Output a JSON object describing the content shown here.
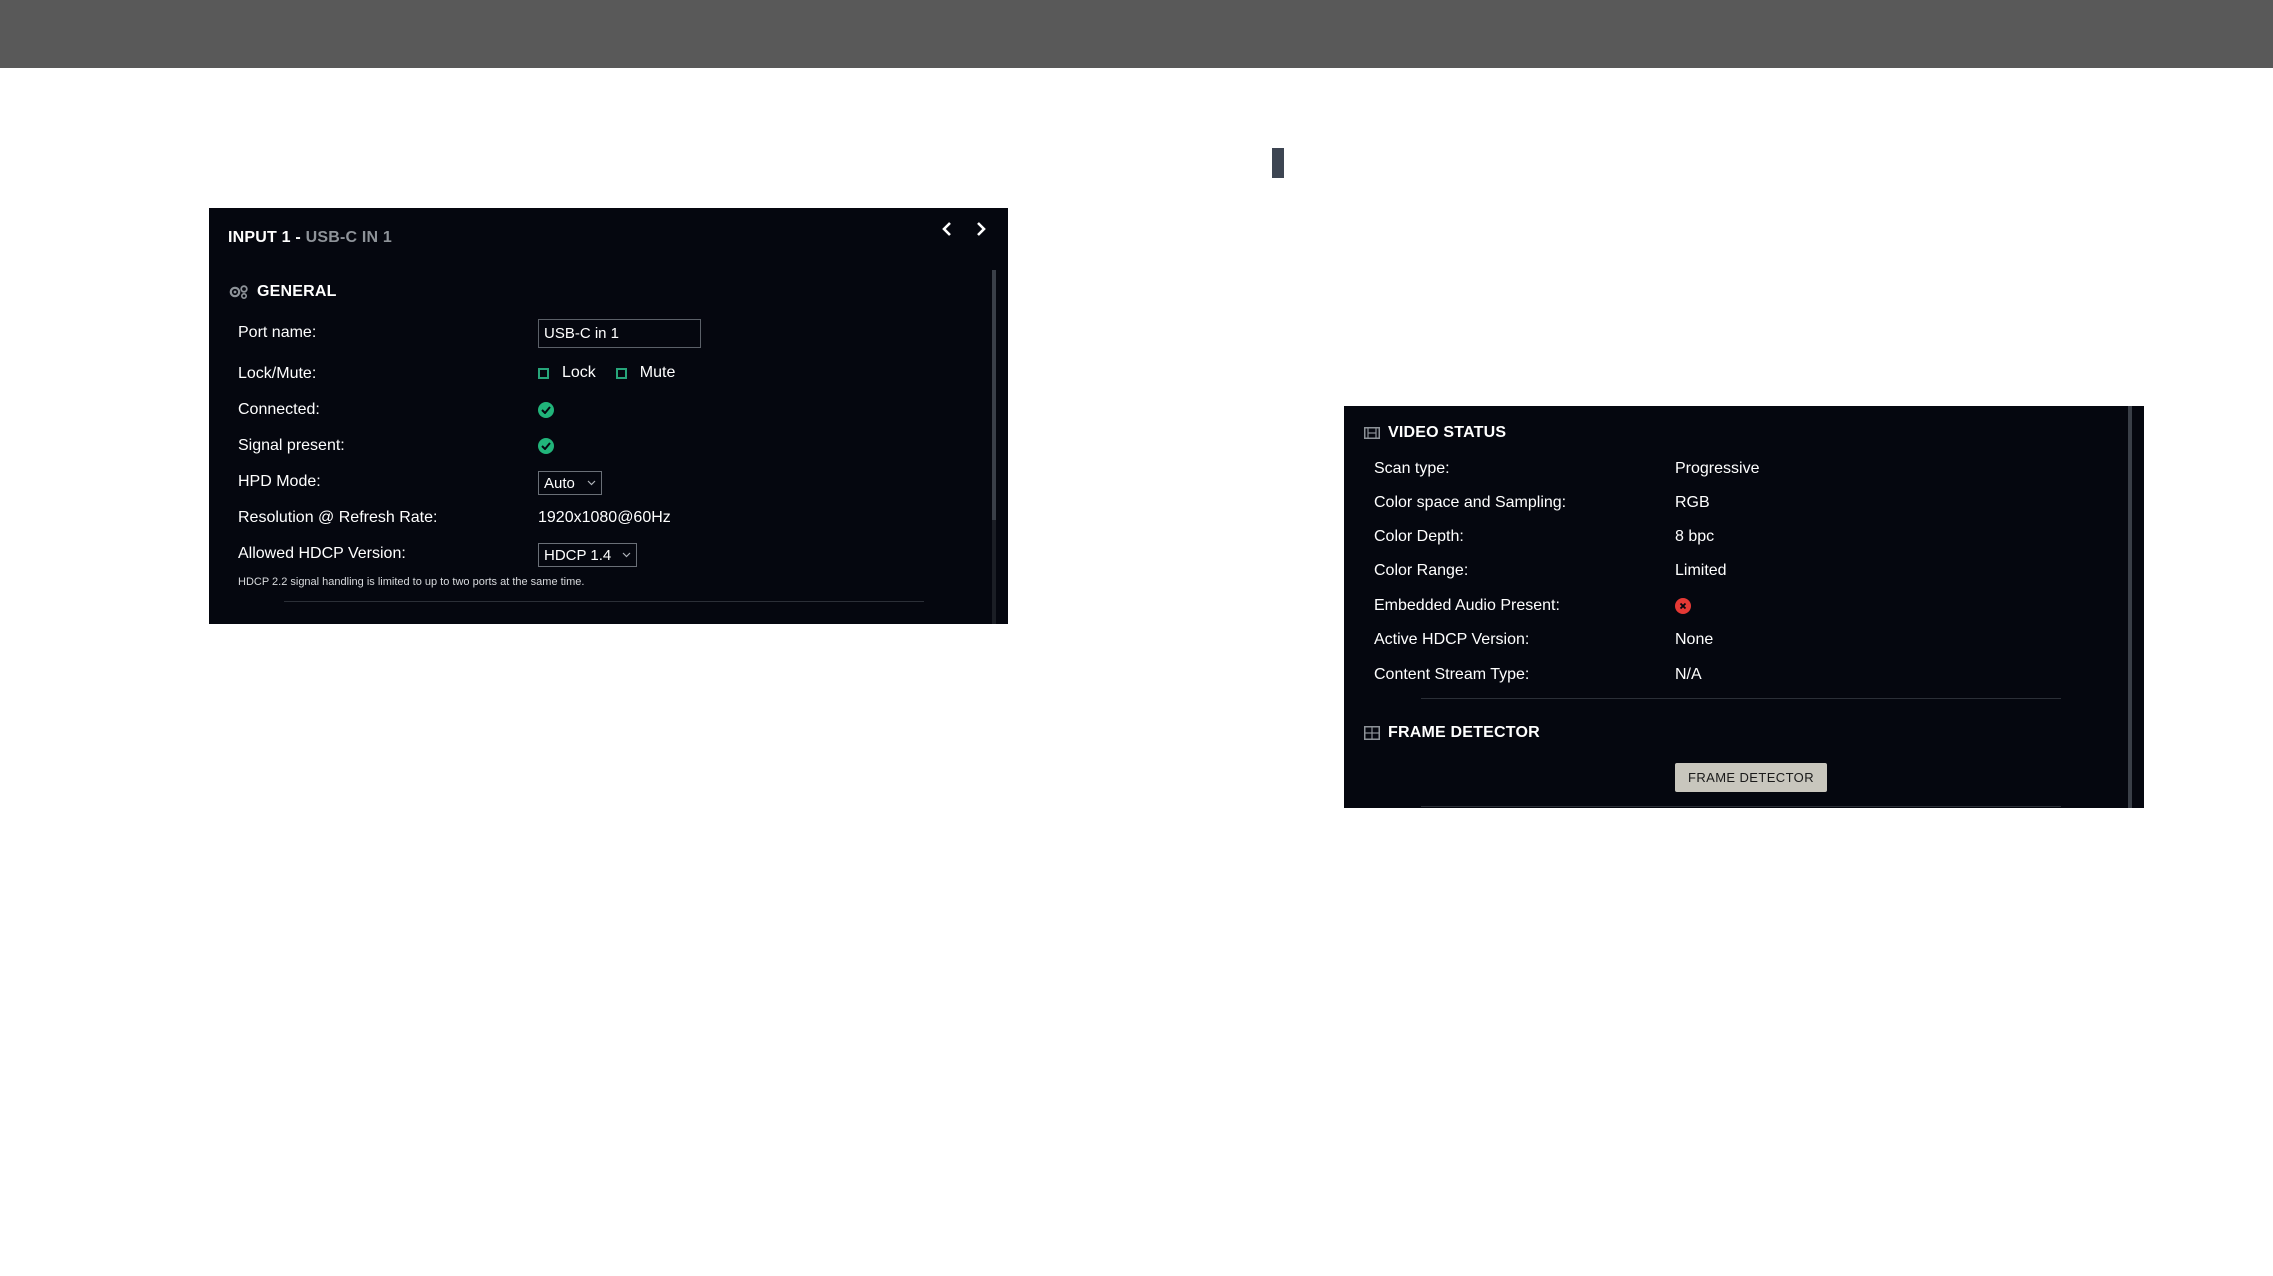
{
  "input_panel": {
    "title": "INPUT 1",
    "separator": " - ",
    "subtitle": "USB-C IN 1",
    "general": {
      "heading": "GENERAL",
      "icon": "gears-icon",
      "port_name": {
        "label": "Port name:",
        "value": "USB-C in 1"
      },
      "lock_mute": {
        "label": "Lock/Mute:",
        "lock_label": "Lock",
        "mute_label": "Mute",
        "lock_checked": false,
        "mute_checked": false
      },
      "connected": {
        "label": "Connected:",
        "status": "ok"
      },
      "signal_present": {
        "label": "Signal present:",
        "status": "ok"
      },
      "hpd_mode": {
        "label": "HPD Mode:",
        "value": "Auto"
      },
      "resolution": {
        "label": "Resolution @ Refresh Rate:",
        "value": "1920x1080@60Hz"
      },
      "hdcp": {
        "label": "Allowed HDCP Version:",
        "value": "HDCP 1.4"
      },
      "note": "HDCP 2.2 signal handling is limited to up to two ports at the same time."
    }
  },
  "video_status": {
    "heading": "VIDEO STATUS",
    "icon": "film-icon",
    "rows": [
      {
        "label": "Scan type:",
        "value": "Progressive"
      },
      {
        "label": "Color space and Sampling:",
        "value": "RGB"
      },
      {
        "label": "Color Depth:",
        "value": "8 bpc"
      },
      {
        "label": "Color Range:",
        "value": "Limited"
      },
      {
        "label": "Embedded Audio Present:",
        "value": "",
        "status": "error"
      },
      {
        "label": "Active HDCP Version:",
        "value": "None"
      },
      {
        "label": "Content Stream Type:",
        "value": "N/A"
      }
    ]
  },
  "frame_detector": {
    "heading": "FRAME DETECTOR",
    "icon": "grid-icon",
    "button_label": "FRAME DETECTOR"
  },
  "colors": {
    "panel_bg": "#05070f",
    "accent_green": "#21b47a",
    "error_red": "#e53935",
    "top_bar": "#595959"
  }
}
